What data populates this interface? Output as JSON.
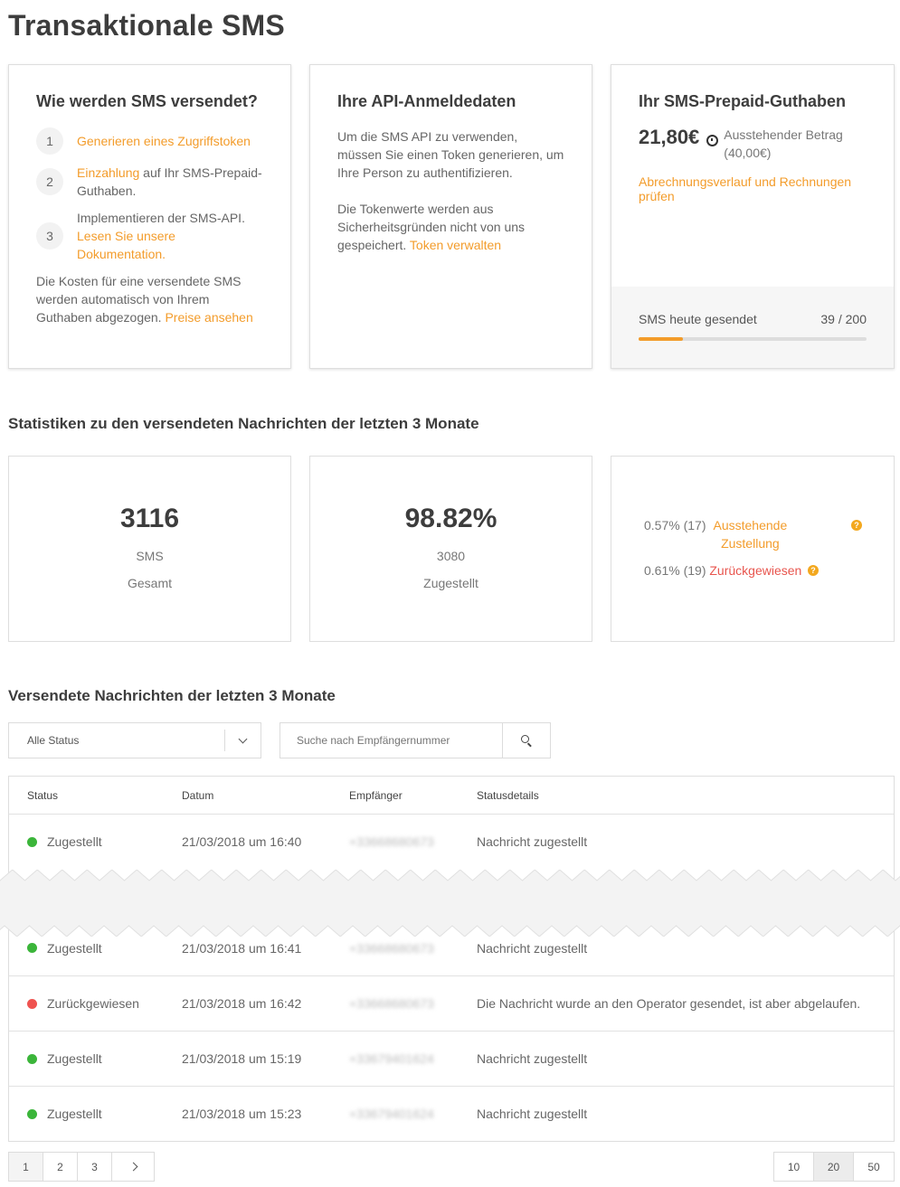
{
  "page": {
    "title": "Transaktionale SMS"
  },
  "howto": {
    "title": "Wie werden SMS versendet?",
    "steps": [
      {
        "num": "1",
        "link": "Generieren eines Zugriffstoken",
        "text": ""
      },
      {
        "num": "2",
        "link": "Einzahlung",
        "text": " auf Ihr SMS-Prepaid-Guthaben."
      },
      {
        "num": "3",
        "pre": "Implementieren der SMS-API. ",
        "link": "Lesen Sie unsere Dokumentation."
      }
    ],
    "footer_text": "Die Kosten für eine versendete SMS werden automatisch von Ihrem Guthaben abgezogen. ",
    "footer_link": "Preise ansehen"
  },
  "api": {
    "title": "Ihre API-Anmeldedaten",
    "p1": "Um die SMS API zu verwenden, müssen Sie einen Token generieren, um Ihre Person zu authentifizieren.",
    "p2": "Die Tokenwerte werden aus Sicherheitsgründen nicht von uns gespeichert. ",
    "p2_link": "Token verwalten"
  },
  "credit": {
    "title": "Ihr SMS-Prepaid-Guthaben",
    "balance": "21,80€",
    "pending_label": "Ausstehender Betrag",
    "pending_value": "(40,00€)",
    "history_link": "Abrechnungsverlauf und Rechnungen prüfen",
    "sent_label": "SMS heute gesendet",
    "sent_value": "39 / 200",
    "sent_fraction": 0.195
  },
  "stats": {
    "title": "Statistiken zu den versendeten Nachrichten der letzten 3 Monate",
    "total": {
      "value": "3116",
      "unit": "SMS",
      "label": "Gesamt"
    },
    "delivered": {
      "value": "98.82%",
      "count": "3080",
      "label": "Zugestellt"
    },
    "pending": {
      "value": "0.57% (17) ",
      "label": "Ausstehende Zustellung"
    },
    "rejected": {
      "value": "0.61% (19) ",
      "label": "Zurückgewiesen"
    }
  },
  "messages": {
    "title": "Versendete Nachrichten der letzten 3 Monate",
    "status_filter": "Alle Status",
    "search_placeholder": "Suche nach Empfängernummer",
    "columns": [
      "Status",
      "Datum",
      "Empfänger",
      "Statusdetails"
    ],
    "rows": [
      {
        "status": "Zugestellt",
        "ok": true,
        "date": "21/03/2018 um 16:40",
        "recipient": "+33668680673",
        "details": "Nachricht zugestellt"
      },
      {
        "status": "Zugestellt",
        "ok": true,
        "date": "21/03/2018 um 16:41",
        "recipient": "+33668680673",
        "details": "Nachricht zugestellt"
      },
      {
        "status": "Zurückgewiesen",
        "ok": false,
        "date": "21/03/2018 um 16:42",
        "recipient": "+33668680673",
        "details": "Die Nachricht wurde an den Operator gesendet, ist aber abgelaufen."
      },
      {
        "status": "Zugestellt",
        "ok": true,
        "date": "21/03/2018 um 15:19",
        "recipient": "+33679401624",
        "details": "Nachricht zugestellt"
      },
      {
        "status": "Zugestellt",
        "ok": true,
        "date": "21/03/2018 um 15:23",
        "recipient": "+33679401624",
        "details": "Nachricht zugestellt"
      }
    ]
  },
  "pagination": {
    "pages": [
      "1",
      "2",
      "3"
    ],
    "current": "1",
    "per_page": [
      "10",
      "20",
      "50"
    ],
    "per_page_selected": "20"
  },
  "colors": {
    "accent": "#f39c2b",
    "success": "#3bb53a",
    "danger": "#ef5350"
  }
}
